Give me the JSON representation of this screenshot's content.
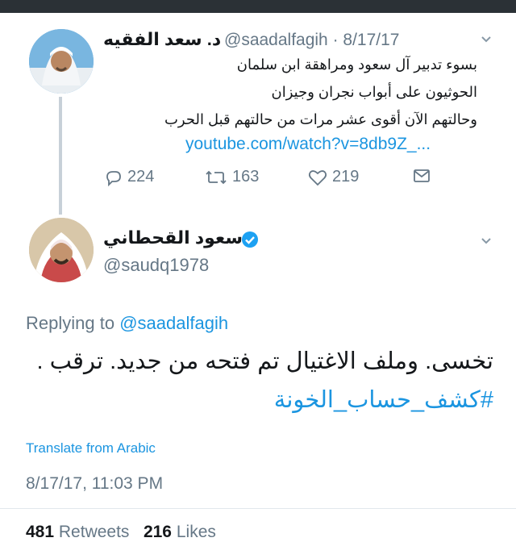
{
  "quoted_tweet": {
    "author_name": "د. سعد الفقيه",
    "handle": "@saadalfagih",
    "date": "8/17/17",
    "lines": [
      "بسوء تدبير آل سعود ومراهقة ابن سلمان",
      "الحوثيون على أبواب نجران وجيزان",
      "وحالتهم الآن أقوى عشر مرات من حالتهم قبل الحرب"
    ],
    "link": "youtube.com/watch?v=8db9Z_...",
    "replies": "224",
    "retweets": "163",
    "likes": "219"
  },
  "main_tweet": {
    "author_name": "سعود القحطاني",
    "handle": "@saudq1978",
    "replying_prefix": "Replying to",
    "replying_to": "@saadalfagih",
    "body": "تخسى. وملف الاغتيال تم فتحه من جديد. ترقب .",
    "hashtag": "#كشف_حساب_الخونة",
    "translate": "Translate from Arabic",
    "timestamp": "8/17/17, 11:03 PM",
    "retweets_count": "481",
    "retweets_label": "Retweets",
    "likes_count": "216",
    "likes_label": "Likes"
  },
  "colors": {
    "link": "#1b95e0",
    "secondary_text": "#657786",
    "verified": "#1da1f2"
  },
  "icons": [
    "reply-icon",
    "retweet-icon",
    "like-icon",
    "message-icon",
    "chevron-down-icon",
    "verified-badge-icon"
  ]
}
